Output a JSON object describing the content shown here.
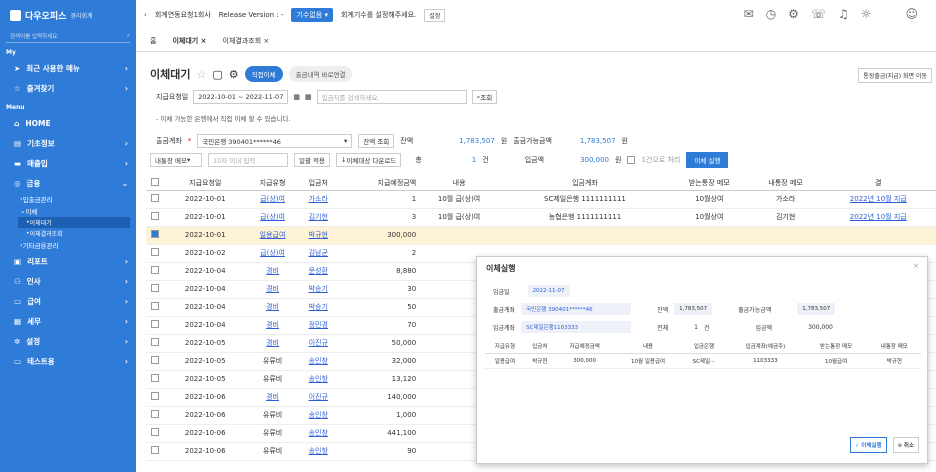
{
  "app": {
    "name": "다우오피스",
    "sub": "경리회계",
    "search_placeholder": "검색어를 입력하세요.",
    "section_my": "My",
    "section_menu": "Menu"
  },
  "sidebar": {
    "my_items": [
      "최근 사용한 메뉴",
      "즐겨찾기"
    ],
    "menu_items": [
      "HOME",
      "기초정보",
      "매출입",
      "금융"
    ],
    "finance_sub": [
      "입출금관리",
      "이체"
    ],
    "transfer_sub": [
      "이체대기",
      "이체결과조회"
    ],
    "finance_sub2": "기타금융관리",
    "rest": [
      "리포트",
      "인사",
      "급여",
      "세무",
      "설정",
      "테스트용"
    ]
  },
  "topbar": {
    "company": "회계연동요청1회사",
    "release_label": "Release Version :",
    "release_value": "-",
    "fiscal_select": "기수없음",
    "fiscal_msg": "회계기수를 설정해주세요.",
    "setting_btn": "설정"
  },
  "tabs": {
    "home": "홈",
    "t1": "이체대기",
    "t2": "이체결과조회"
  },
  "page": {
    "title": "이체대기",
    "mode_active": "직접이체",
    "mode_other": "출금내역 바로연결",
    "top_right": "통장출금(지급) 화면 이동",
    "date_label": "지급요청일",
    "date_range": "2022-10-01 ~ 2022-11-07",
    "search_placeholder": "입금처를 검색하세요.",
    "search_btn": "조회",
    "note": "- 이체 가능한 은행에서 직접 이체 할 수 있습니다.",
    "out_label": "출금계좌",
    "out_account": "국민은행 390401******46",
    "balance_btn": "잔액 조회",
    "balance_label": "잔액",
    "balance": "1,783,507",
    "won": "원",
    "avail_label": "출금가능금액",
    "avail": "1,783,507",
    "memo_select": "내통장 메모",
    "memo_placeholder": "10자 이내 입력",
    "bulk_apply": "일괄 적용",
    "download": "이체대상 다운로드",
    "total_label": "총",
    "total_count": "1",
    "unit_count": "건",
    "in_amount_label": "입금액",
    "in_amount": "300,000",
    "one_case": "1건으로 처리",
    "exec_btn": "이체 실행"
  },
  "table": {
    "headers": [
      "지급요청일",
      "지급유형",
      "입금처",
      "지급예정금액",
      "내용",
      "입금계좌",
      "받는통장 메모",
      "내통장 메모",
      "결"
    ],
    "rows": [
      [
        "2022-10-01",
        "급(상)여",
        "가소라",
        "1",
        "10월 급(상)여",
        "SC제일은행 1111111111",
        "10월상여",
        "가소라",
        "2022년 10월 지급"
      ],
      [
        "2022-10-01",
        "급(상)여",
        "김기현",
        "3",
        "10월 급(상)여",
        "농협은행 1111111111",
        "10월상여",
        "김기현",
        "2022년 10월 지급"
      ],
      [
        "2022-10-01",
        "일용급여",
        "박규현",
        "300,000",
        "",
        "",
        "",
        "",
        ""
      ],
      [
        "2022-10-02",
        "급(상)여",
        "김남균",
        "2",
        "",
        "",
        "",
        "",
        ""
      ],
      [
        "2022-10-04",
        "경비",
        "문성환",
        "8,880",
        "",
        "",
        "",
        "",
        ""
      ],
      [
        "2022-10-04",
        "경비",
        "박승기",
        "30",
        "",
        "",
        "",
        "",
        ""
      ],
      [
        "2022-10-04",
        "경비",
        "박승기",
        "50",
        "",
        "",
        "",
        "",
        ""
      ],
      [
        "2022-10-04",
        "경비",
        "정민경",
        "70",
        "",
        "",
        "",
        "",
        ""
      ],
      [
        "2022-10-05",
        "경비",
        "이진규",
        "50,000",
        "",
        "",
        "",
        "",
        ""
      ],
      [
        "2022-10-05",
        "유류비",
        "송인창",
        "32,000",
        "",
        "",
        "",
        "",
        ""
      ],
      [
        "2022-10-05",
        "유류비",
        "송인창",
        "13,120",
        "",
        "",
        "",
        "",
        ""
      ],
      [
        "2022-10-06",
        "경비",
        "이진규",
        "140,000",
        "",
        "",
        "",
        "",
        ""
      ],
      [
        "2022-10-06",
        "유류비",
        "송인창",
        "1,000",
        "",
        "",
        "",
        "",
        ""
      ],
      [
        "2022-10-06",
        "유류비",
        "송인창",
        "441,100",
        "",
        "",
        "",
        "",
        ""
      ],
      [
        "2022-10-06",
        "유류비",
        "송인창",
        "90",
        "",
        "",
        "",
        "",
        ""
      ]
    ]
  },
  "modal": {
    "title": "이체실행",
    "date_label": "입금일",
    "date": "2022-11-07",
    "out_label": "출금계좌",
    "out_account": "국민은행 390401******46",
    "bal_label": "잔액",
    "bal": "1,783,507",
    "avail_label": "출금가능금액",
    "avail": "1,783,507",
    "in_label": "입금계좌",
    "in_account": "SC제일은행1103333",
    "total_label": "전체",
    "total": "1",
    "unit": "건",
    "amt_label": "입금액",
    "amt": "300,000",
    "headers": [
      "지급유형",
      "입금처",
      "지급예정금액",
      "내용",
      "입금은행",
      "입금계좌(예금주)",
      "받는통장 메모",
      "내통장 메모"
    ],
    "row": [
      "일용급여",
      "박규현",
      "300,000",
      "10월 일용급여",
      "SC제일···",
      "1103333",
      "10월급여",
      "박규현"
    ],
    "confirm": "이체실행",
    "cancel": "취소"
  }
}
